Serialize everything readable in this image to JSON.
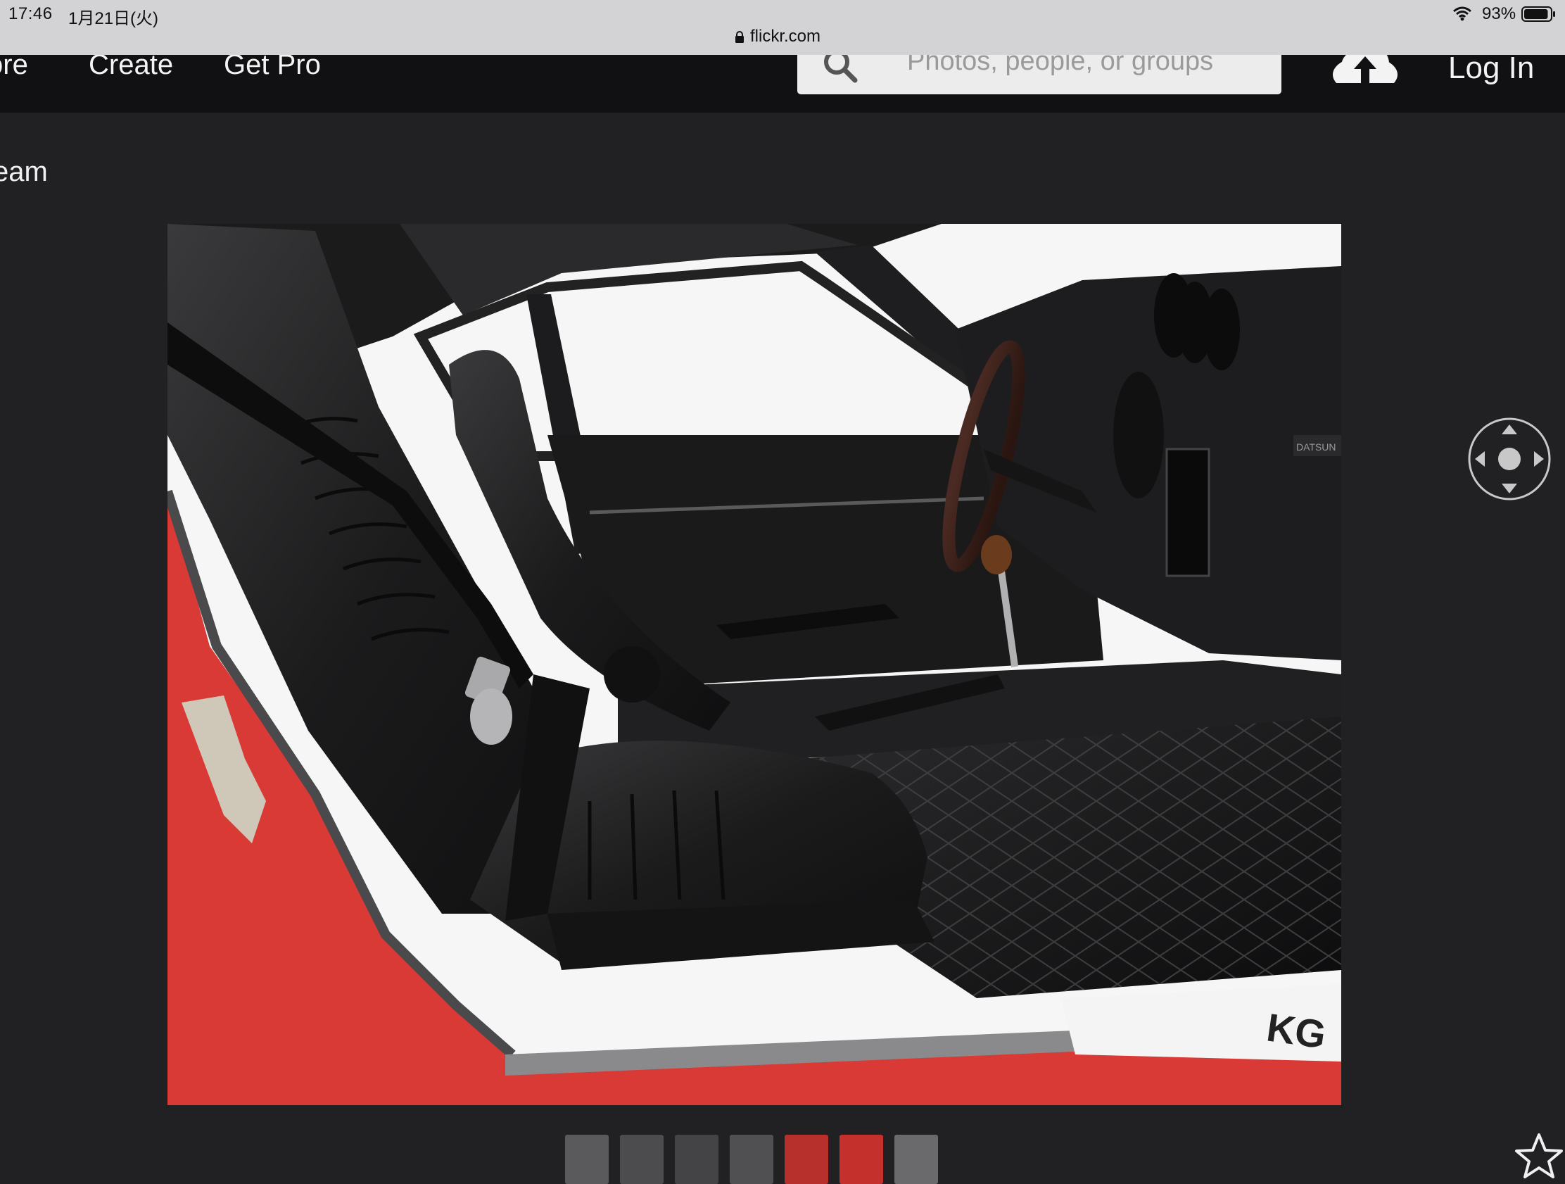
{
  "status_bar": {
    "time": "17:46",
    "date": "1月21日(火)",
    "url": "flickr.com",
    "battery_percent": "93%",
    "battery_level": 0.93
  },
  "nav": {
    "explore": "ore",
    "create": "Create",
    "get_pro": "Get Pro",
    "search_placeholder": "Photos, people, or groups",
    "log_in": "Log In"
  },
  "page": {
    "photostream_title": "eam"
  },
  "photo": {
    "subject": "car interior with black leather bucket seats",
    "visible_text": [
      "DATSUN",
      "KG"
    ]
  },
  "thumbnails": {
    "count": 7,
    "colors": [
      "#5a5a5c",
      "#4c4c4e",
      "#444446",
      "#505052",
      "#b8302c",
      "#c4302c",
      "#6a6a6c"
    ]
  },
  "icons": {
    "lock": "lock-icon",
    "wifi": "wifi-icon",
    "battery": "battery-icon",
    "search": "search-icon",
    "upload": "upload-icon",
    "pan": "pan-control-icon",
    "favorite": "star-icon"
  }
}
